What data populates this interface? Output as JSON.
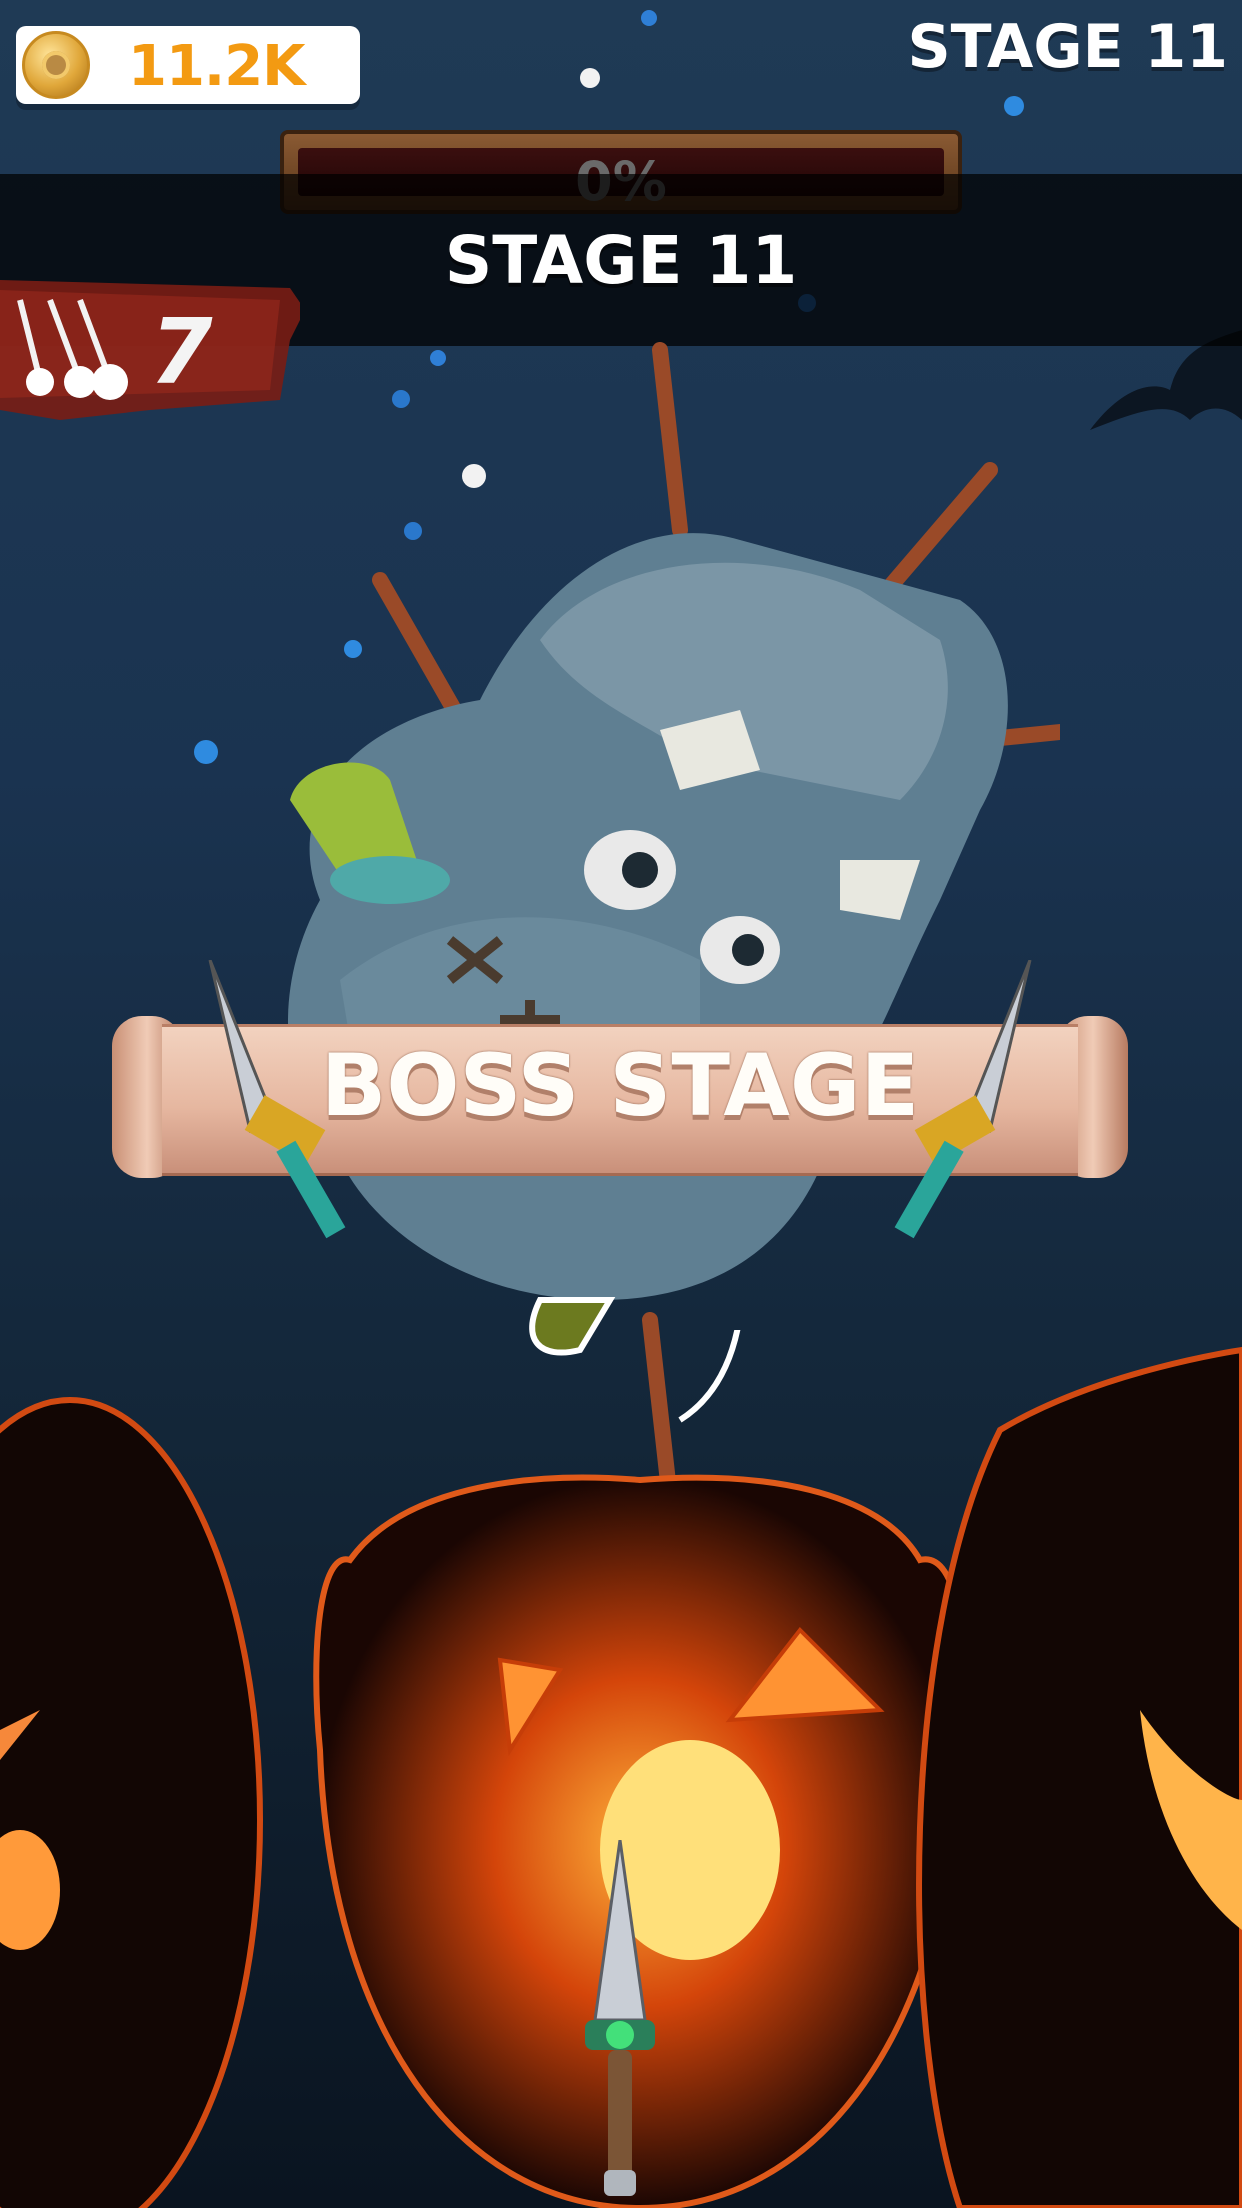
{
  "hud": {
    "coins": "11.2K",
    "coin_icon": "coin-icon",
    "stage_label": "STAGE 11"
  },
  "progress": {
    "text": "0%",
    "value": 0
  },
  "stage_banner": "STAGE 11",
  "knife_counter": {
    "icon": "knife-stack-icon",
    "value": "7"
  },
  "boss_banner": {
    "text": "BOSS STAGE"
  },
  "colors": {
    "coin_text": "#f39a12",
    "background_top": "#1f3a55",
    "background_bottom": "#0a1420",
    "pumpkin_glow": "#ff7a1a"
  }
}
